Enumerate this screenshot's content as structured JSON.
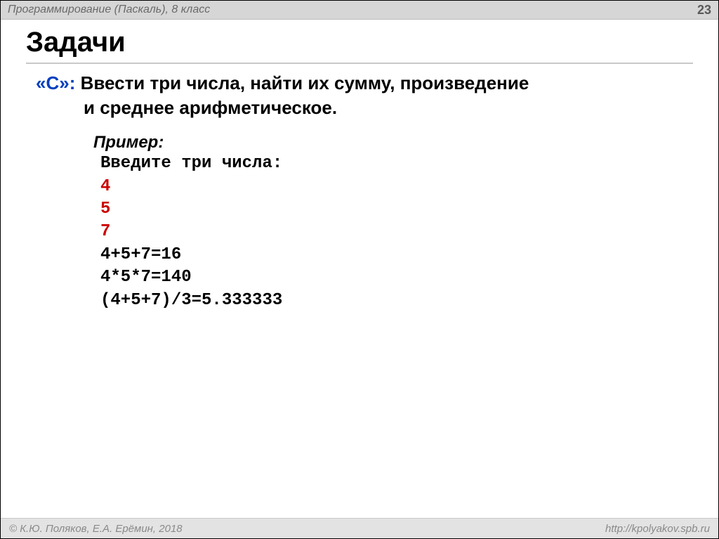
{
  "header": {
    "course_title": "Программирование (Паскаль), 8 класс",
    "page_number": "23"
  },
  "title": "Задачи",
  "task": {
    "label": "«С»:",
    "line1_rest": " Ввести три числа, найти их сумму, произведение",
    "line2": "и среднее арифметическое."
  },
  "example": {
    "heading": "Пример:",
    "prompt": "Введите три числа:",
    "inputs": [
      "4",
      "5",
      "7"
    ],
    "out_sum": "4+5+7=16",
    "out_prod": "4*5*7=140",
    "out_avg": "(4+5+7)/3=5.333333"
  },
  "footer": {
    "copyright": "© К.Ю. Поляков, Е.А. Ерёмин, 2018",
    "url": "http://kpolyakov.spb.ru"
  }
}
